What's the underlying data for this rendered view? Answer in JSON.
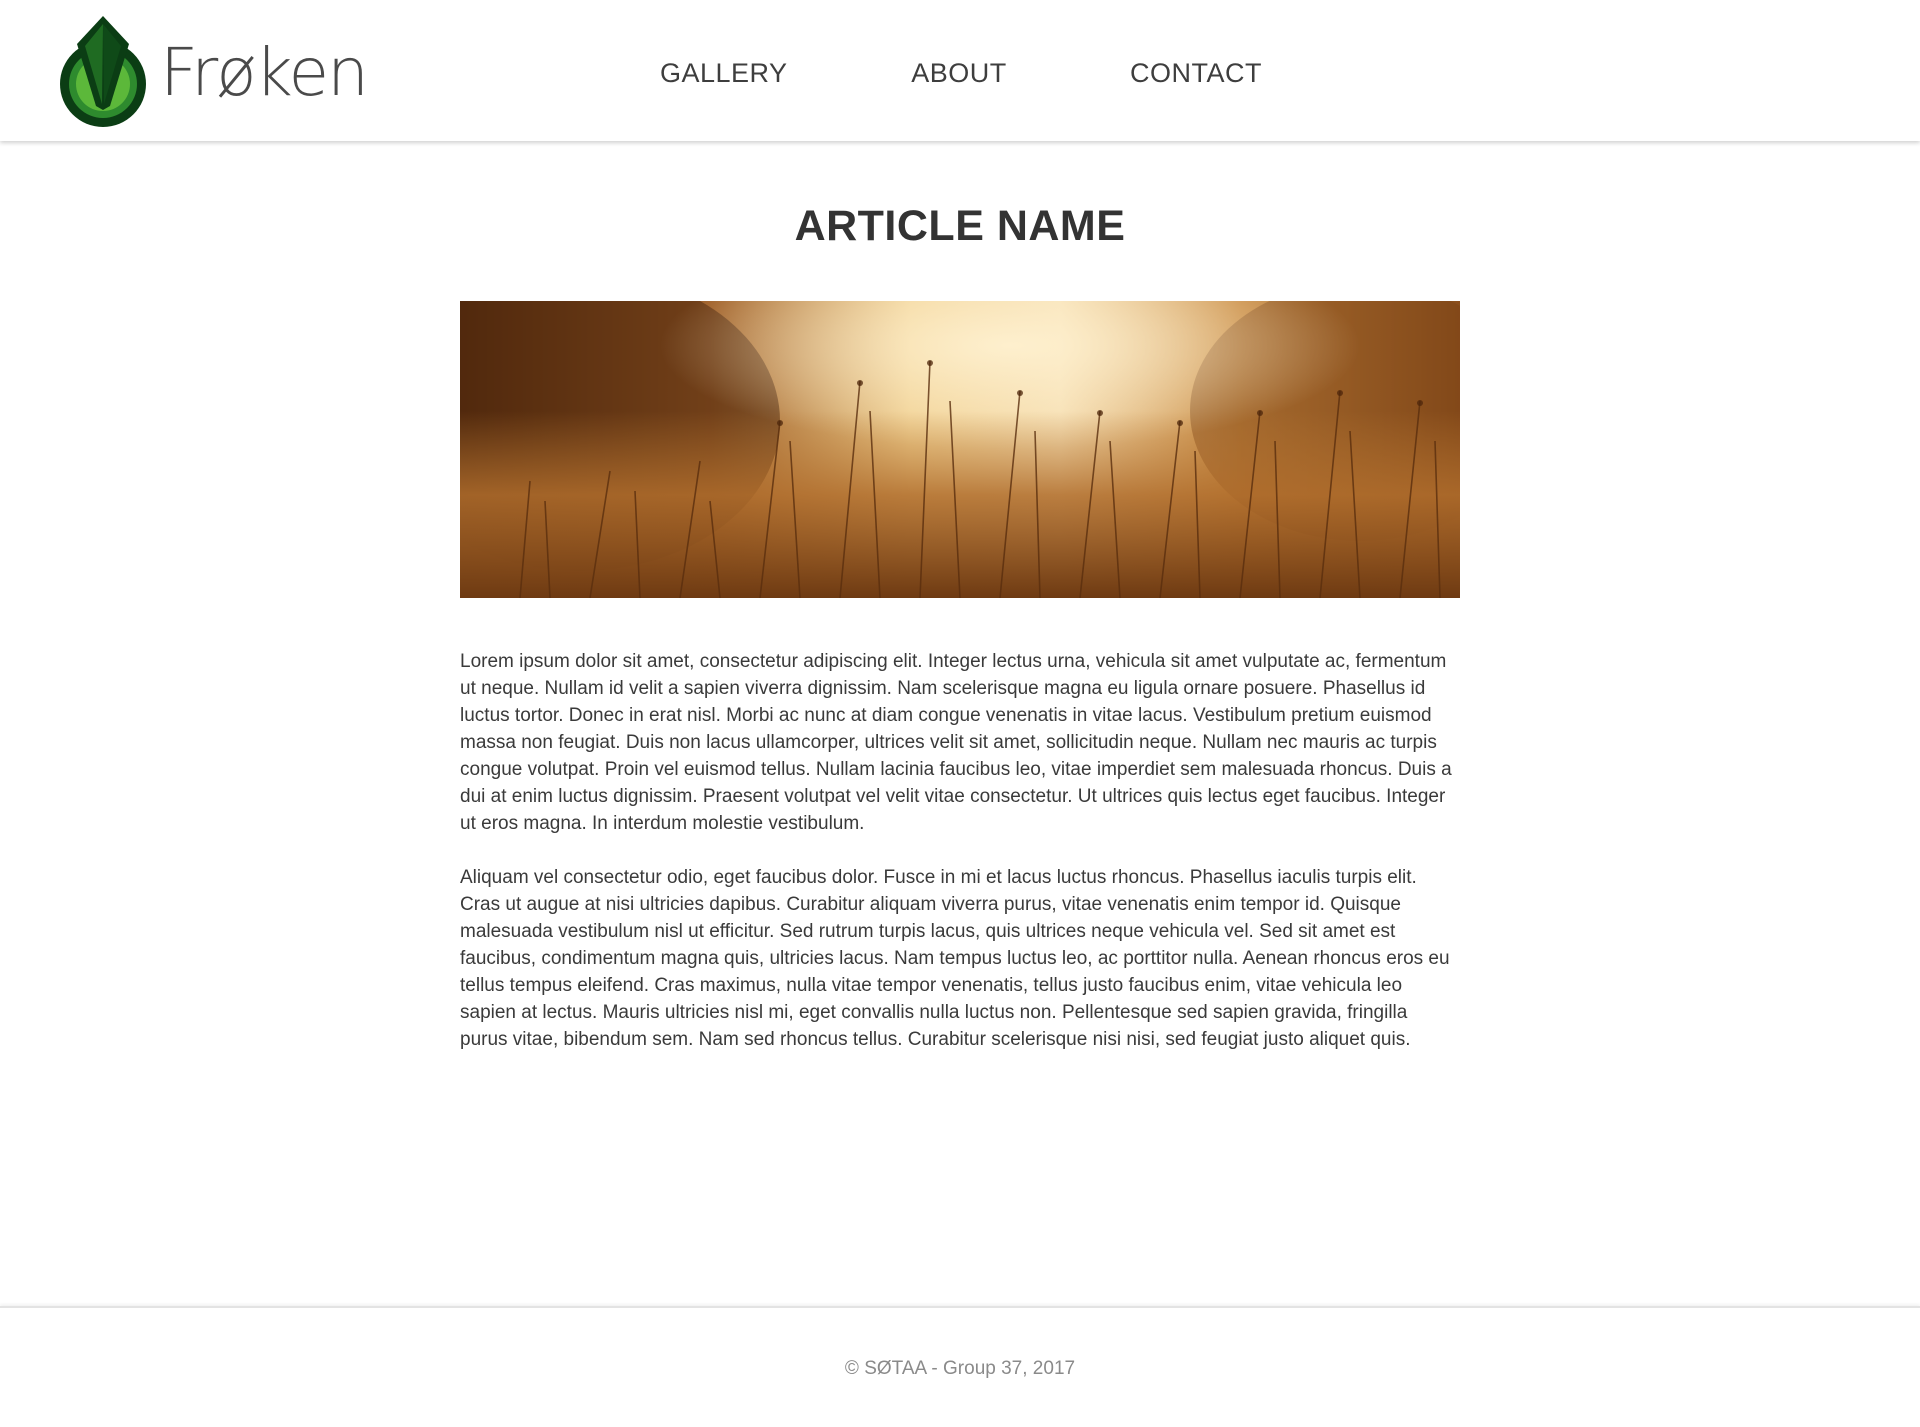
{
  "header": {
    "logo_text": "Frøken",
    "nav": {
      "gallery": "GALLERY",
      "about": "ABOUT",
      "contact": "CONTACT"
    }
  },
  "main": {
    "title": "ARTICLE NAME",
    "paragraphs": [
      "Lorem ipsum dolor sit amet, consectetur adipiscing elit. Integer lectus urna, vehicula sit amet vulputate ac, fermentum ut neque. Nullam id velit a sapien viverra dignissim. Nam scelerisque magna eu ligula ornare posuere. Phasellus id luctus tortor. Donec in erat nisl. Morbi ac nunc at diam congue venenatis in vitae lacus. Vestibulum pretium euismod massa non feugiat. Duis non lacus ullamcorper, ultrices velit sit amet, sollicitudin neque. Nullam nec mauris ac turpis congue volutpat. Proin vel euismod tellus. Nullam lacinia faucibus leo, vitae imperdiet sem malesuada rhoncus. Duis a dui at enim luctus dignissim. Praesent volutpat vel velit vitae consectetur. Ut ultrices quis lectus eget faucibus. Integer ut eros magna. In interdum molestie vestibulum.",
      " Aliquam vel consectetur odio, eget faucibus dolor. Fusce in mi et lacus luctus rhoncus. Phasellus iaculis turpis elit. Cras ut augue at nisi ultricies dapibus. Curabitur aliquam viverra purus, vitae venenatis enim tempor id. Quisque malesuada vestibulum nisl ut efficitur. Sed rutrum turpis lacus, quis ultrices neque vehicula vel. Sed sit amet est faucibus, condimentum magna quis, ultricies lacus. Nam tempus luctus leo, ac porttitor nulla. Aenean rhoncus eros eu tellus tempus eleifend. Cras maximus, nulla vitae tempor venenatis, tellus justo faucibus enim, vitae vehicula leo sapien at lectus. Mauris ultricies nisl mi, eget convallis nulla luctus non. Pellentesque sed sapien gravida, fringilla purus vitae, bibendum sem. Nam sed rhoncus tellus. Curabitur scelerisque nisi nisi, sed feugiat justo aliquet quis."
    ],
    "hero_image": "golden-grass-field-photo"
  },
  "footer": {
    "copyright": "© SØTAA - Group 37, 2017"
  },
  "colors": {
    "logo_dark_green": "#0b3d14",
    "logo_green": "#2e8b2e",
    "logo_light_green": "#5cb83a",
    "text": "#333333",
    "footer_text": "#8a8a8a"
  }
}
